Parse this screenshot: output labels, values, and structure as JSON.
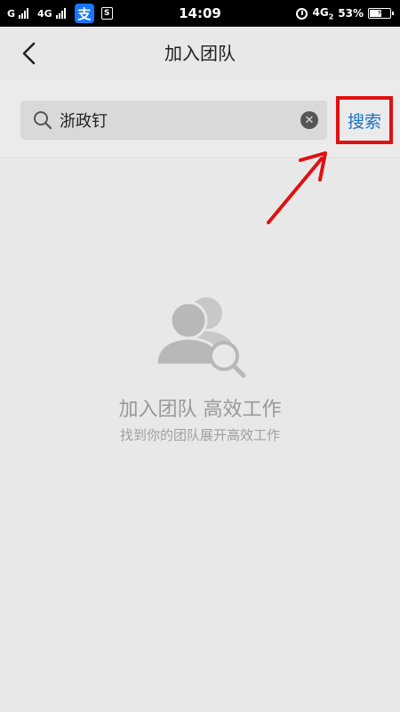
{
  "status_bar": {
    "network_left": "G",
    "network_mid": "4G",
    "alipay_glyph": "支",
    "s_glyph": "S",
    "time": "14:09",
    "network_right": "4G",
    "network_right_sub": "2",
    "battery": "53%"
  },
  "nav": {
    "title": "加入团队",
    "back_icon": "chevron-left-icon"
  },
  "search": {
    "value": "浙政钉",
    "button_label": "搜索",
    "search_icon": "search-icon",
    "clear_icon": "close-circle-icon"
  },
  "empty_state": {
    "icon": "team-search-icon",
    "title": "加入团队 高效工作",
    "subtitle": "找到你的团队展开高效工作"
  },
  "colors": {
    "highlight_box": "#e01010",
    "search_link": "#1a73c8",
    "background": "#e8e8e8"
  }
}
